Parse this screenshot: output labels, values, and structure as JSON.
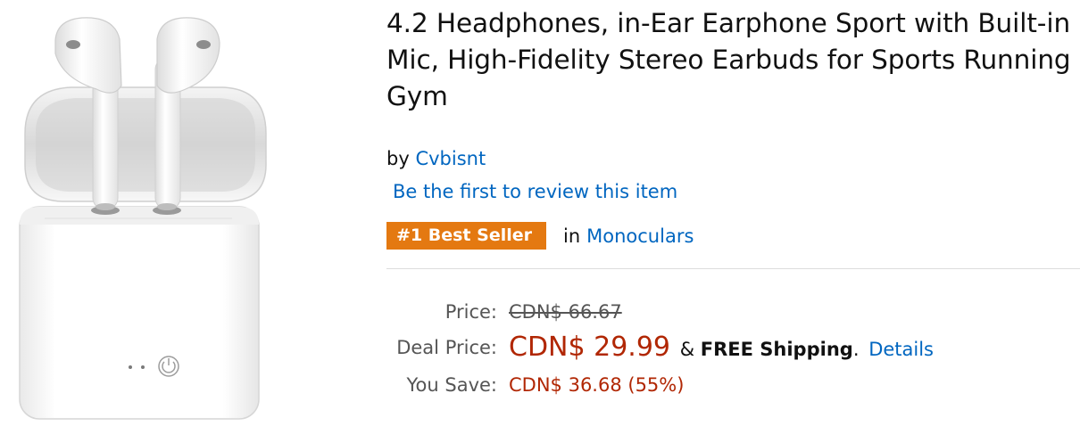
{
  "product": {
    "title": "4.2 Headphones, in-Ear Earphone Sport with Built-in Mic, High-Fidelity Stereo Earbuds for Sports Running Gym",
    "by_prefix": "by",
    "brand": "Cvbisnt",
    "review_link": "Be the first to review this item",
    "badge": "#1 Best Seller",
    "badge_in": "in",
    "badge_category": "Monoculars",
    "image_alt": "white wireless earbuds with charging case"
  },
  "pricing": {
    "price_label": "Price:",
    "list_price": "CDN$ 66.67",
    "deal_label": "Deal Price:",
    "deal_price": "CDN$ 29.99",
    "shipping_prefix": "&",
    "free_shipping": "FREE Shipping",
    "shipping_period": ".",
    "details_link": "Details",
    "save_label": "You Save:",
    "save_value": "CDN$ 36.68 (55%)"
  },
  "colors": {
    "link": "#0066c0",
    "badge": "#e47911",
    "price_red": "#b12704",
    "divider": "#dddddd"
  }
}
